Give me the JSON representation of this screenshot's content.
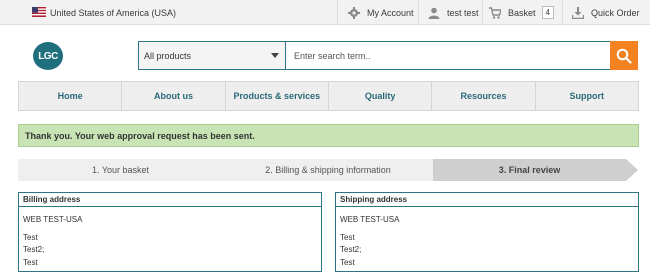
{
  "topbar": {
    "country": "United States of America (USA)",
    "my_account": "My Account",
    "user": "test test",
    "basket": "Basket",
    "basket_count": "4",
    "quick_order": "Quick Order"
  },
  "header": {
    "logo": "LGC",
    "search_scope": "All products",
    "search_placeholder": "Enter search term.."
  },
  "nav": {
    "items": [
      "Home",
      "About us",
      "Products & services",
      "Quality",
      "Resources",
      "Support"
    ]
  },
  "alert": "Thank you. Your web approval request has been sent.",
  "steps": [
    "1. Your basket",
    "2. Billing & shipping information",
    "3. Final review"
  ],
  "billing": {
    "title": "Billing address",
    "lines": [
      "WEB TEST-USA",
      "Test",
      "Test2;",
      "Test"
    ]
  },
  "shipping": {
    "title": "Shipping address",
    "lines": [
      "WEB TEST-USA",
      "Test",
      "Test2;",
      "Test"
    ]
  },
  "colors": {
    "brand_teal": "#2b7585",
    "search_button": "#f58220",
    "alert_bg": "#c8e4b4"
  }
}
